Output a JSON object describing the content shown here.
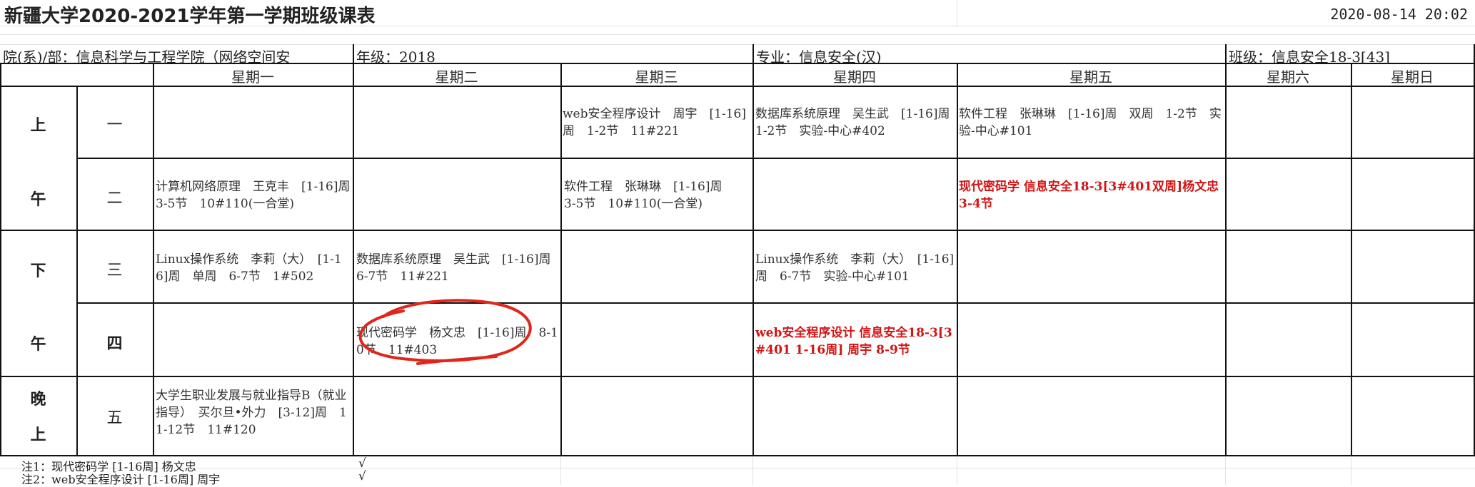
{
  "title": "新疆大学2020-2021学年第一学期班级课表",
  "timestamp": "2020-08-14 20:02",
  "info": {
    "department": "院(系)/部：信息科学与工程学院（网络空间安",
    "grade": "年级：2018",
    "major": "专业：信息安全(汉)",
    "class_name": "班级：信息安全18-3[43]"
  },
  "days": [
    "星期一",
    "星期二",
    "星期三",
    "星期四",
    "星期五",
    "星期六",
    "星期日"
  ],
  "periods": [
    {
      "chars": [
        "上",
        "午"
      ]
    },
    {
      "chars": [
        "下",
        "午"
      ]
    },
    {
      "chars": [
        "晚",
        "上"
      ]
    }
  ],
  "slots": [
    "一",
    "二",
    "三",
    "四",
    "五"
  ],
  "courses": {
    "wed_1": "web安全程序设计　周宇　[1-16]周　1-2节　11#221",
    "thu_1": "数据库系统原理　吴生武　[1-16]周　1-2节　实验-中心#402",
    "fri_1": "软件工程　张琳琳　[1-16]周　双周　1-2节　实验-中心#101",
    "mon_2": "计算机网络原理　王克丰　[1-16]周　3-5节　10#110(一合堂)",
    "wed_2": "软件工程　张琳琳　[1-16]周　　3-5节　10#110(一合堂)",
    "fri_2": "现代密码学 信息安全18-3[3#401双周]杨文忠 3-4节",
    "mon_3": "Linux操作系统　李莉（大）　[1-16]周　单周　6-7节　1#502",
    "tue_3": "数据库系统原理　吴生武　[1-16]周　6-7节　11#221",
    "thu_3": "Linux操作系统　李莉（大）　[1-16]周　6-7节　实验-中心#101",
    "tue_4": "现代密码学　杨文忠　[1-16]周　8-10节　11#403",
    "thu_4": "web安全程序设计 信息安全18-3[3#401 1-16周] 周宇 8-9节",
    "mon_5": "大学生职业发展与就业指导B（就业指导）　买尔旦•外力　[3-12]周　11-12节　11#120"
  },
  "notes": [
    {
      "text": "注1：现代密码学 [1-16周] 杨文忠",
      "check": "√"
    },
    {
      "text": "注2：web安全程序设计 [1-16周] 周宇",
      "check": "√"
    }
  ],
  "colors": {
    "highlight_text": "#d21414",
    "annotation_circle": "#e0261b"
  }
}
